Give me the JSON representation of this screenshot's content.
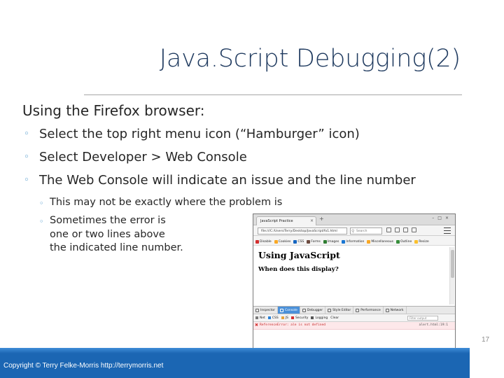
{
  "slide": {
    "title": "Java.Script Debugging(2)",
    "bullet_main": "Using the Firefox browser:",
    "sub_bullets": [
      "Select the top right menu icon (“Hamburger” icon)",
      "Select Developer > Web Console",
      "The Web Console will indicate an issue and the line number"
    ],
    "sub_sub_bullets": [
      "This may not be exactly where the problem is",
      "Sometimes the error is",
      "one or two lines above",
      "the indicated line number."
    ],
    "footer": "Copyright © Terry Felke-Morris http://terrymorris.net",
    "page_number": "17",
    "accent_color": "#1b66b3",
    "bullet_marker_color": "#3b8ec6"
  },
  "browser": {
    "tab_title": "JavaScript Practice",
    "url": "file:///C:/Users/Terry/Desktop/JavaScript/fo1.html",
    "search_placeholder": "Search",
    "bookmarks": [
      {
        "label": "Disable",
        "color": "#d32f2f"
      },
      {
        "label": "Cookies",
        "color": "#f9a825"
      },
      {
        "label": "CSS",
        "color": "#1565c0"
      },
      {
        "label": "Forms",
        "color": "#6d4c41"
      },
      {
        "label": "Images",
        "color": "#2e7d32"
      },
      {
        "label": "Information",
        "color": "#1976d2"
      },
      {
        "label": "Miscellaneous",
        "color": "#f9a825"
      },
      {
        "label": "Outline",
        "color": "#388e3c"
      },
      {
        "label": "Resize",
        "color": "#fbc02d"
      }
    ],
    "page_heading": "Using JavaScript",
    "page_subheading": "When does this display?",
    "devtools_tabs": [
      "Inspector",
      "Console",
      "Debugger",
      "Style Editor",
      "Performance",
      "Network"
    ],
    "devtools_active_tab": "Console",
    "filter_tabs": [
      "Net",
      "CSS",
      "JS",
      "Security",
      "Logging",
      "Clear"
    ],
    "filter_placeholder": "Filter output",
    "error_message": "ReferenceError: ale is not defined",
    "error_location": "alert.html:19:1",
    "console_prompt": "»"
  }
}
